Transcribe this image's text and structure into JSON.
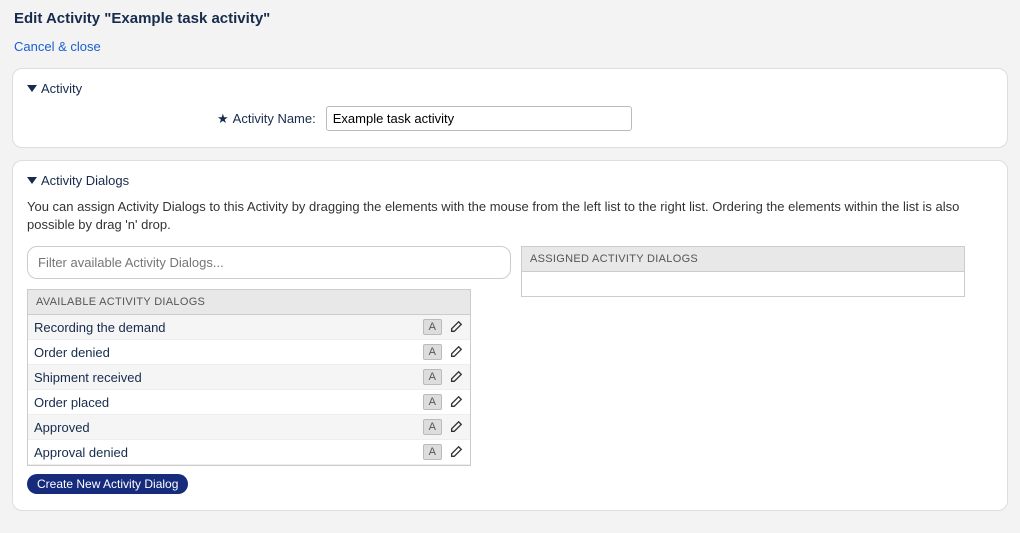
{
  "page": {
    "title": "Edit Activity \"Example task activity\"",
    "cancel_label": "Cancel & close"
  },
  "activity_section": {
    "header": "Activity",
    "name_label": "Activity Name:",
    "name_value": "Example task activity"
  },
  "dialogs_section": {
    "header": "Activity Dialogs",
    "help": "You can assign Activity Dialogs to this Activity by dragging the elements with the mouse from the left list to the right list. Ordering the elements within the list is also possible by drag 'n' drop.",
    "filter_placeholder": "Filter available Activity Dialogs...",
    "available_header": "AVAILABLE ACTIVITY DIALOGS",
    "assigned_header": "ASSIGNED ACTIVITY DIALOGS",
    "badge": "A",
    "available": [
      {
        "label": "Recording the demand"
      },
      {
        "label": "Order denied"
      },
      {
        "label": "Shipment received"
      },
      {
        "label": "Order placed"
      },
      {
        "label": "Approved"
      },
      {
        "label": "Approval denied"
      }
    ],
    "create_label": "Create New Activity Dialog"
  }
}
